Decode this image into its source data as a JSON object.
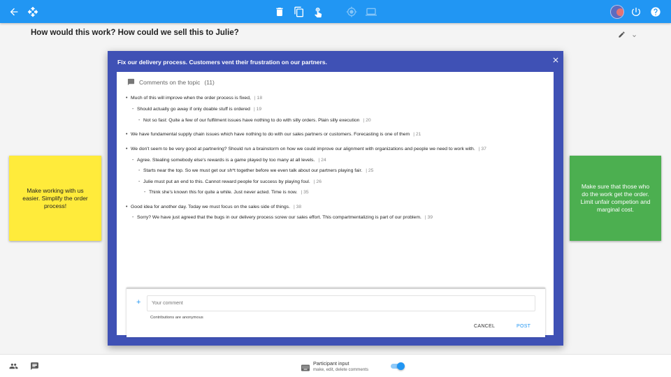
{
  "toolbar": {
    "icons": [
      "arrow-back-icon",
      "move-icon",
      "delete-icon",
      "copy-icon",
      "touch-icon",
      "target-icon",
      "screen-icon",
      "avatar",
      "power-icon",
      "help-icon"
    ],
    "accent": "#2196f3"
  },
  "page": {
    "title": "How would this work? How could we sell this to Julie?"
  },
  "notes": {
    "left": {
      "text": "Make working with us easier. Simplify the order process!",
      "color": "#ffeb3b"
    },
    "right": {
      "text": "Make sure that those who do the work get the order. Limit unfair competion and marginal cost.",
      "color": "#4caf50"
    }
  },
  "dialog": {
    "title": "Fix our delivery process. Customers vent their frustration on our partners.",
    "color": "#3f51b5",
    "comments_label": "Comments on the topic",
    "comments_count": "(11)",
    "comments": [
      {
        "text": "Much of this will improve when the order process is fixed,",
        "num": "| 18"
      },
      {
        "text": "Should actually go away if only doable stuff is ordered",
        "num": "| 19"
      },
      {
        "text": "Not so fast: Quite a few of our fulfilment issues have nothing to do with silly orders. Plain silly execution",
        "num": "| 20"
      },
      {
        "text": "We have fundamental supply chain issues which have nothing to do with our sales partners or customers. Forecasting is one of them",
        "num": "| 21"
      },
      {
        "text": "We don't seem to be very good at partnering? Should run a brainstorm on how we could improve our alignment with organizations and people we need to work with.",
        "num": "| 37"
      },
      {
        "text": "Agree. Stealing somebody else's rewards is a game played by too many at all levels.",
        "num": "| 24"
      },
      {
        "text": "Starts near the top. So we must get our sh*t together before we even talk about our partners playing fair.",
        "num": "| 25"
      },
      {
        "text": "Julie must put an end to this. Cannot reward people for success by playing foul.",
        "num": "| 26"
      },
      {
        "text": "Think she's known this for quite a while. Just never acted. Time is now.",
        "num": "| 35"
      },
      {
        "text": "Good idea for another day. Today we must focus on the sales side of things.",
        "num": "| 38"
      },
      {
        "text": "Sorry? We have just agreed that the bugs in our delivery process screw our sales effort. This compartmentalizing is part of our problem.",
        "num": "| 39"
      }
    ],
    "input_placeholder": "Your comment",
    "input_value": "",
    "anonymous_note": "Contributions are anonymous",
    "cancel_label": "CANCEL",
    "post_label": "POST"
  },
  "bottom": {
    "participant_title": "Participant input",
    "participant_sub": "make, edit, delete comments",
    "toggle_on": true
  }
}
